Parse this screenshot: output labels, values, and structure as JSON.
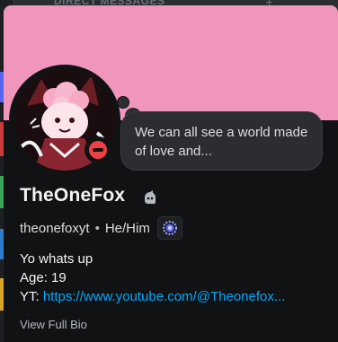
{
  "background": {
    "header_text": "DIRECT MESSAGES",
    "header_plus": "+"
  },
  "profile": {
    "display_name": "TheOneFox",
    "username": "theonefoxyt",
    "separator": "•",
    "pronouns": "He/Him",
    "status": "dnd",
    "custom_status": "We can all see a world made of love and...",
    "bio_lines": {
      "line1": "Yo whats up",
      "line2": "Age: 19",
      "yt_label": "YT: ",
      "yt_link": "https://www.youtube.com/@Theonefox..."
    },
    "view_full_bio": "View Full Bio"
  },
  "colors": {
    "banner": "#f096bc",
    "card_bg": "#111214",
    "dnd": "#f23f43",
    "link": "#00a8fc"
  },
  "icons": [
    "bot-badge-icon",
    "nitro-badge-icon",
    "dnd-status-icon"
  ]
}
